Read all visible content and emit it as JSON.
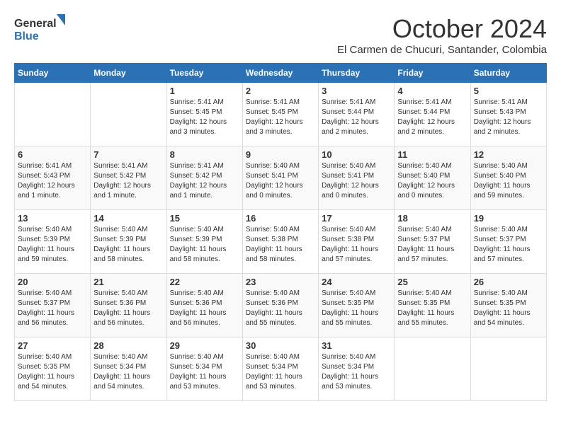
{
  "header": {
    "logo_line1": "General",
    "logo_line2": "Blue",
    "month": "October 2024",
    "location": "El Carmen de Chucuri, Santander, Colombia"
  },
  "weekdays": [
    "Sunday",
    "Monday",
    "Tuesday",
    "Wednesday",
    "Thursday",
    "Friday",
    "Saturday"
  ],
  "weeks": [
    [
      {
        "day": "",
        "sunrise": "",
        "sunset": "",
        "daylight": ""
      },
      {
        "day": "",
        "sunrise": "",
        "sunset": "",
        "daylight": ""
      },
      {
        "day": "1",
        "sunrise": "Sunrise: 5:41 AM",
        "sunset": "Sunset: 5:45 PM",
        "daylight": "Daylight: 12 hours and 3 minutes."
      },
      {
        "day": "2",
        "sunrise": "Sunrise: 5:41 AM",
        "sunset": "Sunset: 5:45 PM",
        "daylight": "Daylight: 12 hours and 3 minutes."
      },
      {
        "day": "3",
        "sunrise": "Sunrise: 5:41 AM",
        "sunset": "Sunset: 5:44 PM",
        "daylight": "Daylight: 12 hours and 2 minutes."
      },
      {
        "day": "4",
        "sunrise": "Sunrise: 5:41 AM",
        "sunset": "Sunset: 5:44 PM",
        "daylight": "Daylight: 12 hours and 2 minutes."
      },
      {
        "day": "5",
        "sunrise": "Sunrise: 5:41 AM",
        "sunset": "Sunset: 5:43 PM",
        "daylight": "Daylight: 12 hours and 2 minutes."
      }
    ],
    [
      {
        "day": "6",
        "sunrise": "Sunrise: 5:41 AM",
        "sunset": "Sunset: 5:43 PM",
        "daylight": "Daylight: 12 hours and 1 minute."
      },
      {
        "day": "7",
        "sunrise": "Sunrise: 5:41 AM",
        "sunset": "Sunset: 5:42 PM",
        "daylight": "Daylight: 12 hours and 1 minute."
      },
      {
        "day": "8",
        "sunrise": "Sunrise: 5:41 AM",
        "sunset": "Sunset: 5:42 PM",
        "daylight": "Daylight: 12 hours and 1 minute."
      },
      {
        "day": "9",
        "sunrise": "Sunrise: 5:40 AM",
        "sunset": "Sunset: 5:41 PM",
        "daylight": "Daylight: 12 hours and 0 minutes."
      },
      {
        "day": "10",
        "sunrise": "Sunrise: 5:40 AM",
        "sunset": "Sunset: 5:41 PM",
        "daylight": "Daylight: 12 hours and 0 minutes."
      },
      {
        "day": "11",
        "sunrise": "Sunrise: 5:40 AM",
        "sunset": "Sunset: 5:40 PM",
        "daylight": "Daylight: 12 hours and 0 minutes."
      },
      {
        "day": "12",
        "sunrise": "Sunrise: 5:40 AM",
        "sunset": "Sunset: 5:40 PM",
        "daylight": "Daylight: 11 hours and 59 minutes."
      }
    ],
    [
      {
        "day": "13",
        "sunrise": "Sunrise: 5:40 AM",
        "sunset": "Sunset: 5:39 PM",
        "daylight": "Daylight: 11 hours and 59 minutes."
      },
      {
        "day": "14",
        "sunrise": "Sunrise: 5:40 AM",
        "sunset": "Sunset: 5:39 PM",
        "daylight": "Daylight: 11 hours and 58 minutes."
      },
      {
        "day": "15",
        "sunrise": "Sunrise: 5:40 AM",
        "sunset": "Sunset: 5:39 PM",
        "daylight": "Daylight: 11 hours and 58 minutes."
      },
      {
        "day": "16",
        "sunrise": "Sunrise: 5:40 AM",
        "sunset": "Sunset: 5:38 PM",
        "daylight": "Daylight: 11 hours and 58 minutes."
      },
      {
        "day": "17",
        "sunrise": "Sunrise: 5:40 AM",
        "sunset": "Sunset: 5:38 PM",
        "daylight": "Daylight: 11 hours and 57 minutes."
      },
      {
        "day": "18",
        "sunrise": "Sunrise: 5:40 AM",
        "sunset": "Sunset: 5:37 PM",
        "daylight": "Daylight: 11 hours and 57 minutes."
      },
      {
        "day": "19",
        "sunrise": "Sunrise: 5:40 AM",
        "sunset": "Sunset: 5:37 PM",
        "daylight": "Daylight: 11 hours and 57 minutes."
      }
    ],
    [
      {
        "day": "20",
        "sunrise": "Sunrise: 5:40 AM",
        "sunset": "Sunset: 5:37 PM",
        "daylight": "Daylight: 11 hours and 56 minutes."
      },
      {
        "day": "21",
        "sunrise": "Sunrise: 5:40 AM",
        "sunset": "Sunset: 5:36 PM",
        "daylight": "Daylight: 11 hours and 56 minutes."
      },
      {
        "day": "22",
        "sunrise": "Sunrise: 5:40 AM",
        "sunset": "Sunset: 5:36 PM",
        "daylight": "Daylight: 11 hours and 56 minutes."
      },
      {
        "day": "23",
        "sunrise": "Sunrise: 5:40 AM",
        "sunset": "Sunset: 5:36 PM",
        "daylight": "Daylight: 11 hours and 55 minutes."
      },
      {
        "day": "24",
        "sunrise": "Sunrise: 5:40 AM",
        "sunset": "Sunset: 5:35 PM",
        "daylight": "Daylight: 11 hours and 55 minutes."
      },
      {
        "day": "25",
        "sunrise": "Sunrise: 5:40 AM",
        "sunset": "Sunset: 5:35 PM",
        "daylight": "Daylight: 11 hours and 55 minutes."
      },
      {
        "day": "26",
        "sunrise": "Sunrise: 5:40 AM",
        "sunset": "Sunset: 5:35 PM",
        "daylight": "Daylight: 11 hours and 54 minutes."
      }
    ],
    [
      {
        "day": "27",
        "sunrise": "Sunrise: 5:40 AM",
        "sunset": "Sunset: 5:35 PM",
        "daylight": "Daylight: 11 hours and 54 minutes."
      },
      {
        "day": "28",
        "sunrise": "Sunrise: 5:40 AM",
        "sunset": "Sunset: 5:34 PM",
        "daylight": "Daylight: 11 hours and 54 minutes."
      },
      {
        "day": "29",
        "sunrise": "Sunrise: 5:40 AM",
        "sunset": "Sunset: 5:34 PM",
        "daylight": "Daylight: 11 hours and 53 minutes."
      },
      {
        "day": "30",
        "sunrise": "Sunrise: 5:40 AM",
        "sunset": "Sunset: 5:34 PM",
        "daylight": "Daylight: 11 hours and 53 minutes."
      },
      {
        "day": "31",
        "sunrise": "Sunrise: 5:40 AM",
        "sunset": "Sunset: 5:34 PM",
        "daylight": "Daylight: 11 hours and 53 minutes."
      },
      {
        "day": "",
        "sunrise": "",
        "sunset": "",
        "daylight": ""
      },
      {
        "day": "",
        "sunrise": "",
        "sunset": "",
        "daylight": ""
      }
    ]
  ]
}
